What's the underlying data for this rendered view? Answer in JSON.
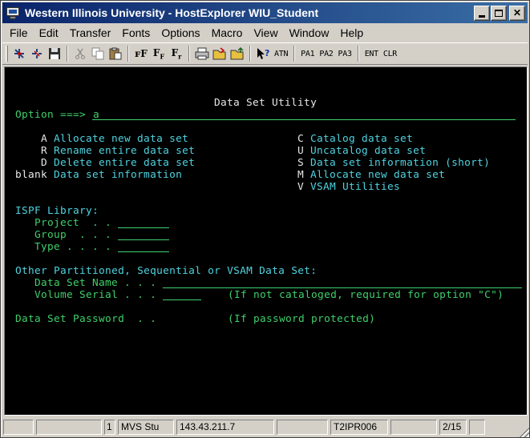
{
  "window": {
    "title": "Western Illinois University - HostExplorer WIU_Student"
  },
  "menu": [
    "File",
    "Edit",
    "Transfer",
    "Fonts",
    "Options",
    "Macro",
    "View",
    "Window",
    "Help"
  ],
  "toolbar": {
    "atn": "ATN",
    "pa1": "PA1",
    "pa2": "PA2",
    "pa3": "PA3",
    "ent": "ENT",
    "clr": "CLR"
  },
  "terminal": {
    "screen_title": "Data Set Utility",
    "option_label": "Option ===>",
    "option_value": "a",
    "left_options": [
      {
        "key": "A",
        "desc": "Allocate new data set"
      },
      {
        "key": "R",
        "desc": "Rename entire data set"
      },
      {
        "key": "D",
        "desc": "Delete entire data set"
      },
      {
        "key": "blank",
        "desc": "Data set information"
      }
    ],
    "right_options": [
      {
        "key": "C",
        "desc": "Catalog data set"
      },
      {
        "key": "U",
        "desc": "Uncatalog data set"
      },
      {
        "key": "S",
        "desc": "Data set information (short)"
      },
      {
        "key": "M",
        "desc": "Allocate new data set"
      },
      {
        "key": "V",
        "desc": "VSAM Utilities"
      }
    ],
    "ispf_header": "ISPF Library:",
    "ispf_fields": [
      {
        "label": "Project  . ."
      },
      {
        "label": "Group  . . ."
      },
      {
        "label": "Type . . . ."
      }
    ],
    "other_header": "Other Partitioned, Sequential or VSAM Data Set:",
    "dsn_label": "Data Set Name . . .",
    "volser_label": "Volume Serial . . .",
    "volser_note": "(If not cataloged, required for option \"C\")",
    "password_label": "Data Set Password  . .",
    "password_note": "(If password protected)"
  },
  "statusbar": {
    "session": "1",
    "system": "MVS Stu",
    "ip": "143.43.211.7",
    "terminal_id": "T2IPR006",
    "cursor": "2/15"
  }
}
